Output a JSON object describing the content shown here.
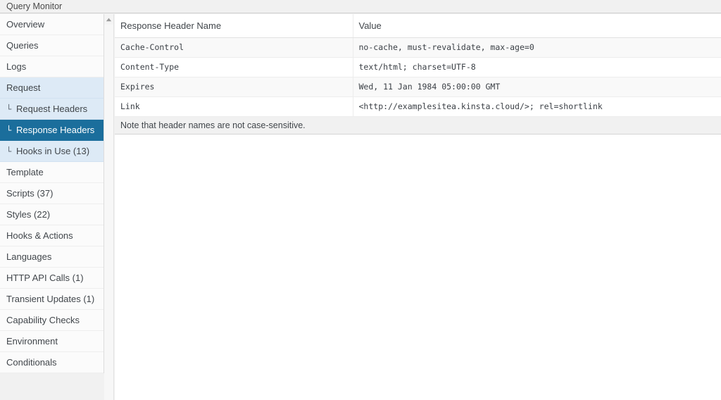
{
  "window": {
    "title": "Query Monitor"
  },
  "colors": {
    "accent_selected": "#1b6e9c",
    "group_highlight": "#ddeaf6",
    "panel_bg": "#f1f1f1",
    "sidebar_bg": "#fbfbfb",
    "table_bg": "#ffffff",
    "table_stripe": "#f9f9f9",
    "text": "#41464b",
    "selected_text": "#ffffff"
  },
  "sidebar": {
    "scroll_up_icon": "triangle-up-icon",
    "sub_glyph": "└",
    "items": [
      {
        "label": "Overview",
        "type": "item",
        "selected": false
      },
      {
        "label": "Queries",
        "type": "item",
        "selected": false
      },
      {
        "label": "Logs",
        "type": "item",
        "selected": false
      },
      {
        "label": "Request",
        "type": "group",
        "selected": false
      },
      {
        "label": "Request Headers",
        "type": "sub",
        "selected": false
      },
      {
        "label": "Response Headers",
        "type": "sub",
        "selected": true
      },
      {
        "label": "Hooks in Use (13)",
        "type": "sub",
        "selected": false
      },
      {
        "label": "Template",
        "type": "item",
        "selected": false
      },
      {
        "label": "Scripts (37)",
        "type": "item",
        "selected": false
      },
      {
        "label": "Styles (22)",
        "type": "item",
        "selected": false
      },
      {
        "label": "Hooks & Actions",
        "type": "item",
        "selected": false
      },
      {
        "label": "Languages",
        "type": "item",
        "selected": false
      },
      {
        "label": "HTTP API Calls (1)",
        "type": "item",
        "selected": false
      },
      {
        "label": "Transient Updates (1)",
        "type": "item",
        "selected": false
      },
      {
        "label": "Capability Checks",
        "type": "item",
        "selected": false
      },
      {
        "label": "Environment",
        "type": "item",
        "selected": false
      },
      {
        "label": "Conditionals",
        "type": "item",
        "selected": false
      }
    ]
  },
  "main": {
    "table": {
      "columns": [
        "Response Header Name",
        "Value"
      ],
      "rows": [
        [
          "Cache-Control",
          "no-cache, must-revalidate, max-age=0"
        ],
        [
          "Content-Type",
          "text/html; charset=UTF-8"
        ],
        [
          "Expires",
          "Wed, 11 Jan 1984 05:00:00 GMT"
        ],
        [
          "Link",
          "<http://examplesitea.kinsta.cloud/>; rel=shortlink"
        ]
      ],
      "footer_note": "Note that header names are not case-sensitive."
    }
  }
}
